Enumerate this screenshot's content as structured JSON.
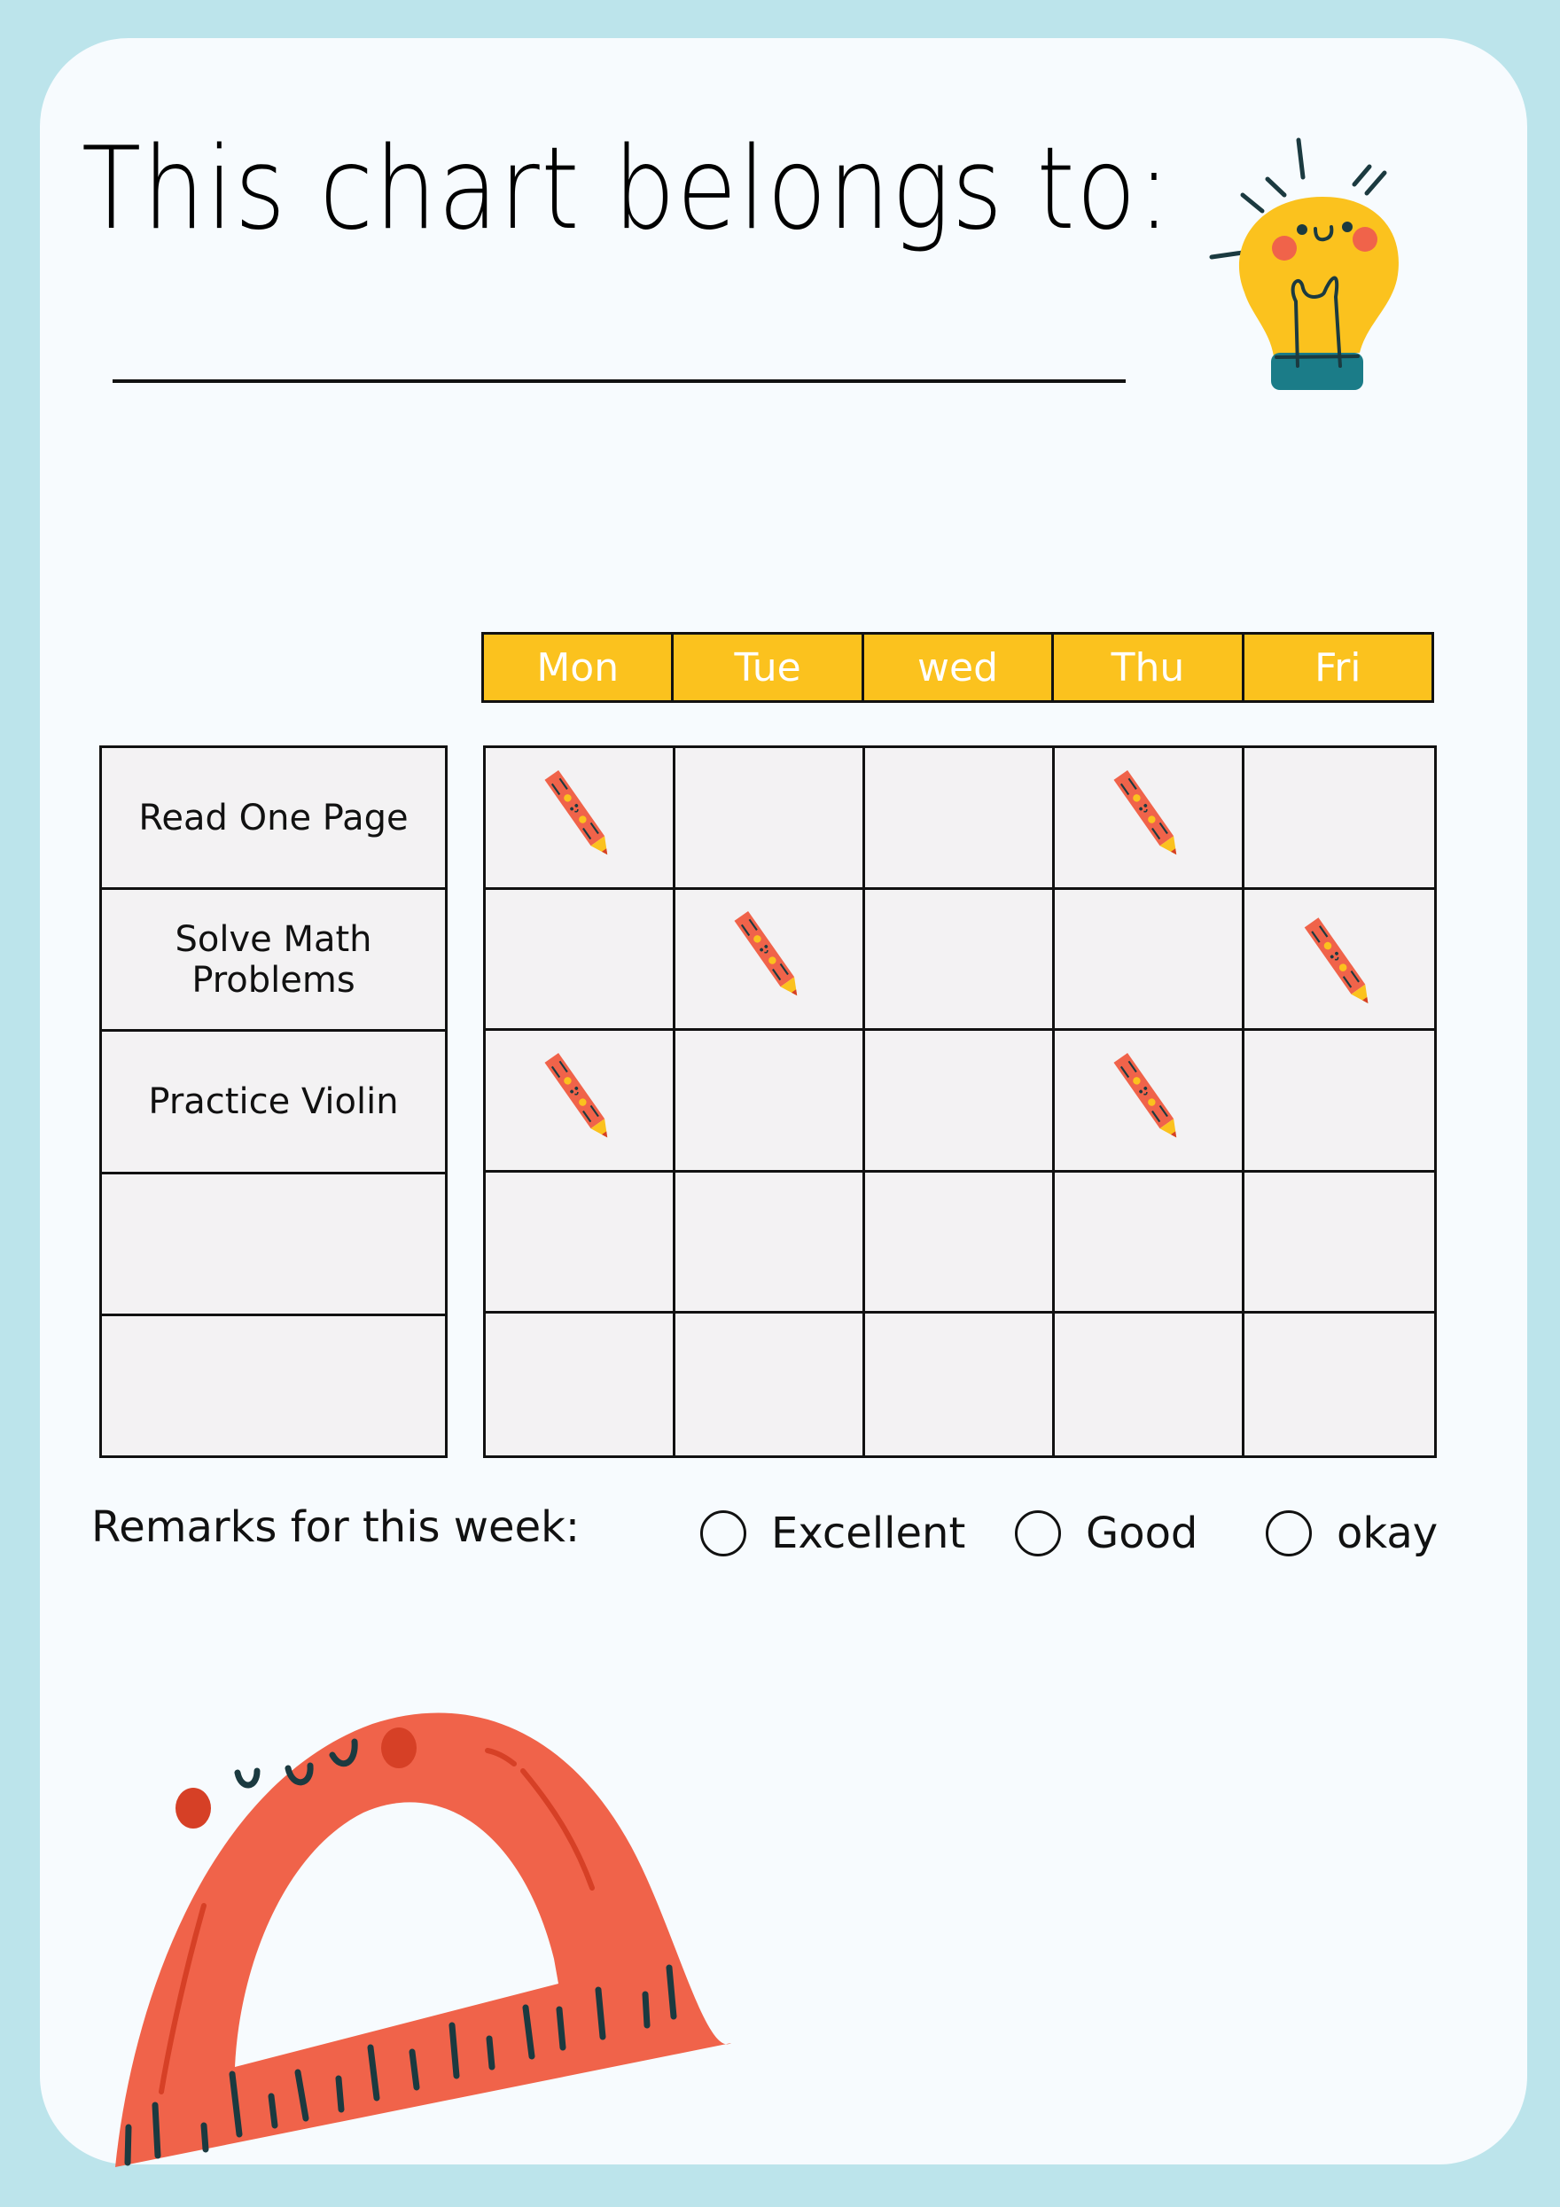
{
  "title": "This chart belongs to:",
  "name_value": "",
  "days": [
    "Mon",
    "Tue",
    "wed",
    "Thu",
    "Fri"
  ],
  "tasks": [
    "Read One Page",
    "Solve Math Problems",
    "Practice Violin",
    "",
    ""
  ],
  "completed": [
    [
      true,
      false,
      false,
      true,
      false
    ],
    [
      false,
      true,
      false,
      false,
      true
    ],
    [
      true,
      false,
      false,
      true,
      false
    ],
    [
      false,
      false,
      false,
      false,
      false
    ],
    [
      false,
      false,
      false,
      false,
      false
    ]
  ],
  "remarks": {
    "label": "Remarks for this week:",
    "options": [
      "Excellent",
      "Good",
      "okay"
    ],
    "selected": null
  },
  "colors": {
    "background": "#bce4eb",
    "card": "#f7fbfe",
    "header": "#fbc21e",
    "cell": "#f3f2f3",
    "accent_red": "#f0634a",
    "dark_line": "#1b3a40"
  },
  "icons": {
    "bulb": "lightbulb-icon",
    "pencil": "pencil-icon",
    "protractor": "protractor-icon"
  }
}
